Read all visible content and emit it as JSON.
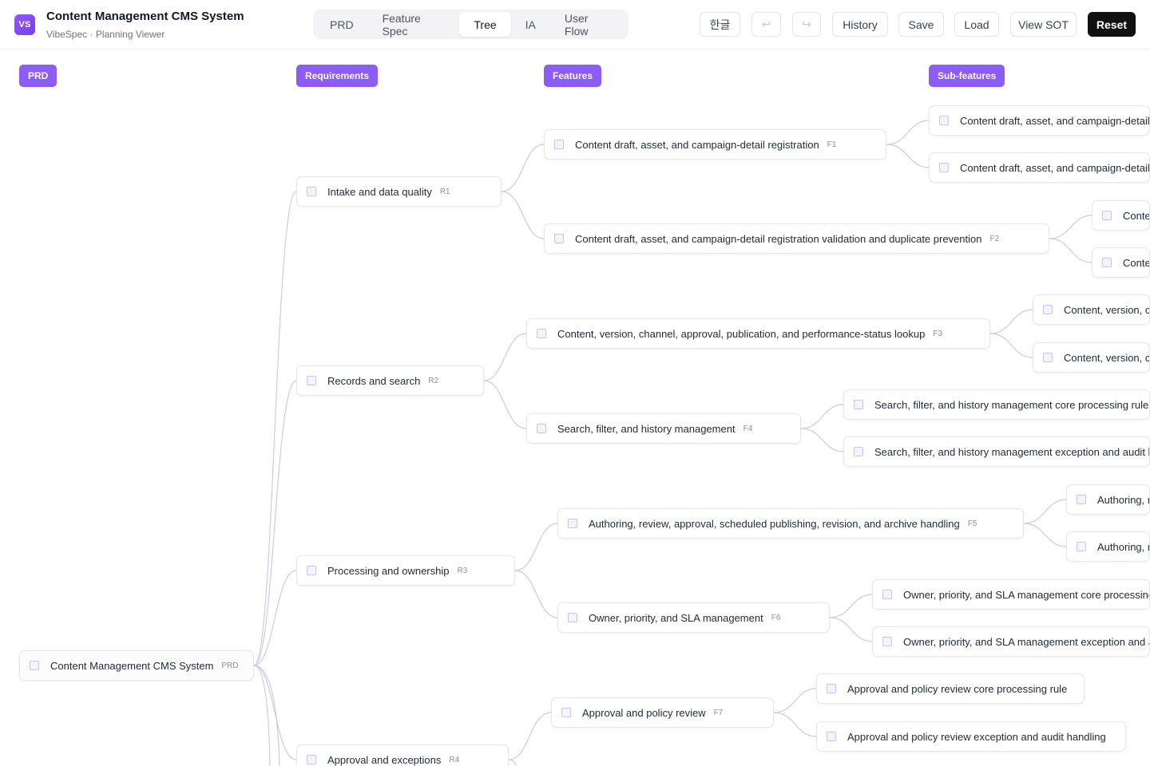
{
  "app": {
    "logo": "VS",
    "title": "Content Management CMS System",
    "subtitle": "VibeSpec · Planning Viewer"
  },
  "tabs": [
    {
      "label": "PRD",
      "active": false
    },
    {
      "label": "Feature Spec",
      "active": false
    },
    {
      "label": "Tree",
      "active": true
    },
    {
      "label": "IA",
      "active": false
    },
    {
      "label": "User Flow",
      "active": false
    }
  ],
  "actions": {
    "language": "한글",
    "undo_icon": "↩",
    "redo_icon": "↪",
    "history": "History",
    "save": "Save",
    "load": "Load",
    "view_sot": "View SOT",
    "reset": "Reset"
  },
  "columns": {
    "prd": "PRD",
    "requirements": "Requirements",
    "features": "Features",
    "subfeatures": "Sub-features"
  },
  "root": {
    "label": "Content Management CMS System",
    "tag": "PRD"
  },
  "requirements": [
    {
      "label": "Intake and data quality",
      "tag": "R1"
    },
    {
      "label": "Records and search",
      "tag": "R2"
    },
    {
      "label": "Processing and ownership",
      "tag": "R3"
    },
    {
      "label": "Approval and exceptions",
      "tag": "R4"
    }
  ],
  "features": [
    {
      "label": "Content draft, asset, and campaign-detail registration",
      "tag": "F1"
    },
    {
      "label": "Content draft, asset, and campaign-detail registration validation and duplicate prevention",
      "tag": "F2"
    },
    {
      "label": "Content, version, channel, approval, publication, and performance-status lookup",
      "tag": "F3"
    },
    {
      "label": "Search, filter, and history management",
      "tag": "F4"
    },
    {
      "label": "Authoring, review, approval, scheduled publishing, revision, and archive handling",
      "tag": "F5"
    },
    {
      "label": "Owner, priority, and SLA management",
      "tag": "F6"
    },
    {
      "label": "Approval and policy review",
      "tag": "F7"
    }
  ],
  "subfeatures": [
    {
      "label": "Content draft, asset, and campaign-detail r"
    },
    {
      "label": "Content draft, asset, and campaign-detail r"
    },
    {
      "label": "Conter"
    },
    {
      "label": "Conter"
    },
    {
      "label": "Content, version, ch"
    },
    {
      "label": "Content, version, ch"
    },
    {
      "label": "Search, filter, and history management core processing rule"
    },
    {
      "label": "Search, filter, and history management exception and audit ha"
    },
    {
      "label": "Authoring, re"
    },
    {
      "label": "Authoring, re"
    },
    {
      "label": "Owner, priority, and SLA management core processing r"
    },
    {
      "label": "Owner, priority, and SLA management exception and au"
    },
    {
      "label": "Approval and policy review core processing rule"
    },
    {
      "label": "Approval and policy review exception and audit handling"
    }
  ]
}
